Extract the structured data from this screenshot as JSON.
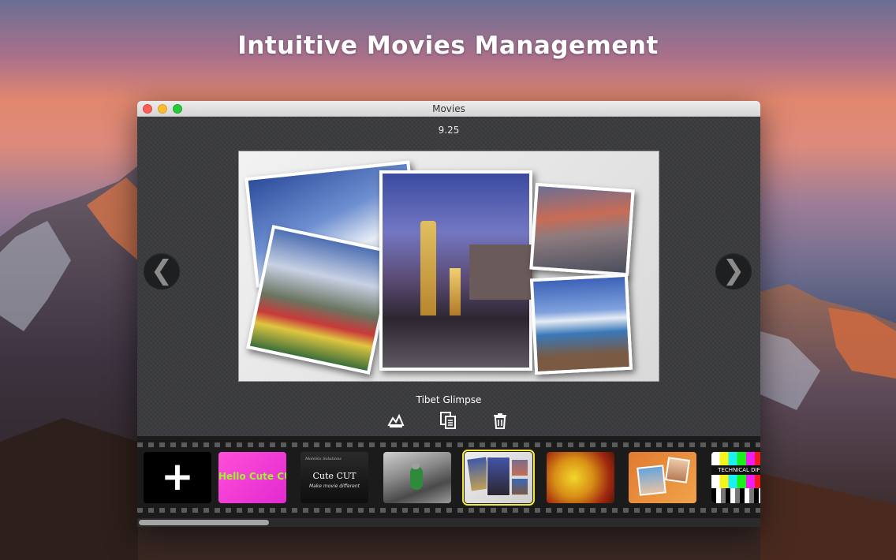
{
  "headline": "Intuitive Movies Management",
  "window": {
    "title": "Movies",
    "version": "9.25",
    "current_movie": "Tibet Glimpse"
  },
  "navigation": {
    "prev_glyph": "❮",
    "next_glyph": "❯"
  },
  "actions": [
    {
      "name": "edit-movie-icon"
    },
    {
      "name": "duplicate-movie-icon"
    },
    {
      "name": "delete-movie-icon"
    }
  ],
  "filmstrip": {
    "add_glyph": "+",
    "thumbs": [
      {
        "label": "Hello Cute CUT"
      },
      {
        "brand": "MoleSix Solutions",
        "title": "Cute CUT",
        "subtitle": "Make movie different"
      },
      {
        "label": ""
      },
      {
        "label": ""
      },
      {
        "label": ""
      },
      {
        "label": ""
      },
      {
        "label": "TECHNICAL DIFFICU"
      }
    ]
  },
  "colors": {
    "selected_outline": "#f5e63a",
    "window_bg": "#3b3c3f",
    "filmstrip_bg": "#1b1b1c"
  }
}
